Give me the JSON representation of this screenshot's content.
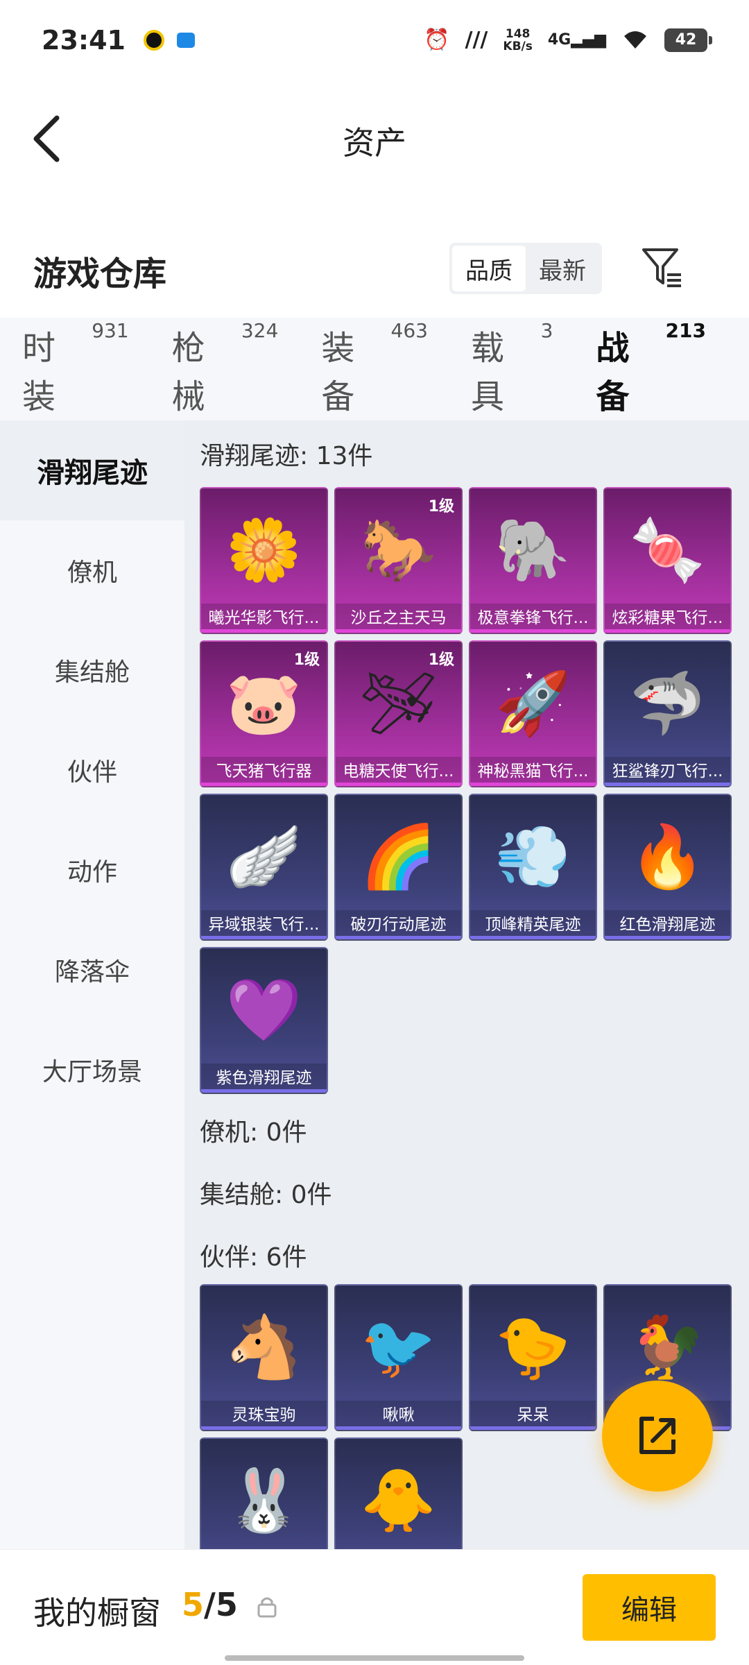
{
  "status_bar": {
    "time": "23:41",
    "speed_value": "148",
    "speed_unit": "KB/s",
    "network": "4G",
    "battery": "42"
  },
  "header": {
    "title": "资产"
  },
  "warehouse": {
    "title": "游戏仓库",
    "sort_quality": "品质",
    "sort_latest": "最新"
  },
  "tabs": [
    {
      "label": "时装",
      "count": "931"
    },
    {
      "label": "枪械",
      "count": "324"
    },
    {
      "label": "装备",
      "count": "463"
    },
    {
      "label": "载具",
      "count": "3"
    },
    {
      "label": "战备",
      "count": "213"
    }
  ],
  "subnav": [
    "滑翔尾迹",
    "僚机",
    "集结舱",
    "伙伴",
    "动作",
    "降落伞",
    "大厅场景"
  ],
  "sections": {
    "glide": {
      "title": "滑翔尾迹: 13件",
      "items": [
        {
          "name": "曦光华影飞行...",
          "level": ""
        },
        {
          "name": "沙丘之主天马",
          "level": "1级"
        },
        {
          "name": "极意拳锋飞行...",
          "level": ""
        },
        {
          "name": "炫彩糖果飞行...",
          "level": ""
        },
        {
          "name": "飞天猪飞行器",
          "level": "1级"
        },
        {
          "name": "电糖天使飞行...",
          "level": "1级"
        },
        {
          "name": "神秘黑猫飞行...",
          "level": ""
        },
        {
          "name": "狂鲨锋刃飞行...",
          "level": ""
        },
        {
          "name": "异域银装飞行...",
          "level": ""
        },
        {
          "name": "破刃行动尾迹",
          "level": ""
        },
        {
          "name": "顶峰精英尾迹",
          "level": ""
        },
        {
          "name": "红色滑翔尾迹",
          "level": ""
        },
        {
          "name": "紫色滑翔尾迹",
          "level": ""
        }
      ]
    },
    "wingman": {
      "title": "僚机: 0件"
    },
    "capsule": {
      "title": "集结舱: 0件"
    },
    "partner": {
      "title": "伙伴: 6件",
      "items": [
        {
          "name": "灵珠宝驹"
        },
        {
          "name": "啾啾"
        },
        {
          "name": "呆呆"
        },
        {
          "name": ""
        },
        {
          "name": ""
        },
        {
          "name": ""
        }
      ]
    }
  },
  "bottom_bar": {
    "title": "我的橱窗",
    "current": "5",
    "separator": "/",
    "total": "5",
    "edit": "编辑"
  }
}
